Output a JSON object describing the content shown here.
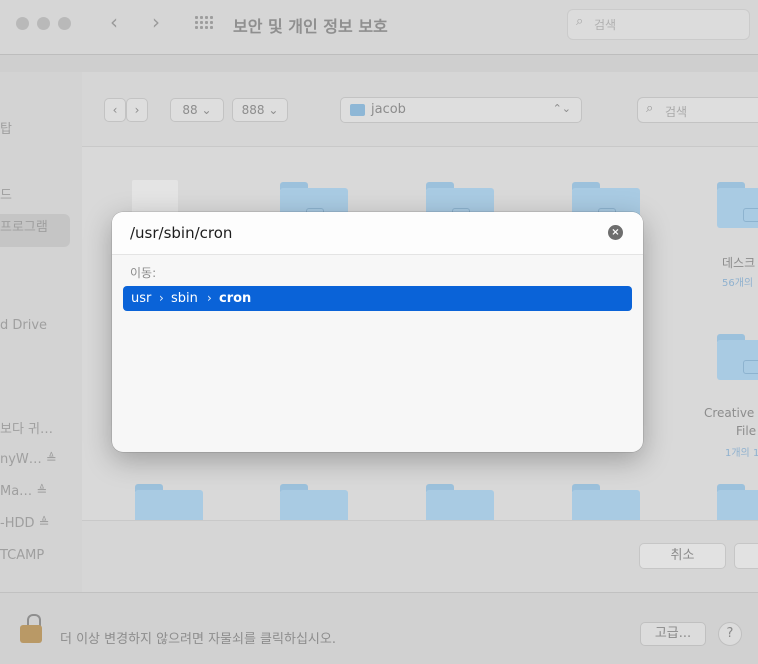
{
  "window": {
    "title": "보안 및 개인 정보 보호",
    "search_placeholder": "검색",
    "back_glyph": "‹",
    "forward_glyph": "›"
  },
  "sidebar": {
    "items": [
      "탑",
      "드",
      "프로그램",
      "d Drive",
      "보다 귀…",
      "nyW… ≜",
      "Ma… ≜",
      "-HDD ≜",
      "TCAMP"
    ]
  },
  "sheet": {
    "location": "jacob",
    "search_placeholder": "검색",
    "view_icons_label": "88 ⌄",
    "view_groups_label": "888 ⌄",
    "files": [
      {
        "name": "데스크",
        "sub": "56개의"
      },
      {
        "name": "Creative",
        "name2": "File",
        "sub": "1개의 1"
      }
    ],
    "cancel_label": "취소"
  },
  "goto": {
    "path_value": "/usr/sbin/cron",
    "clear_glyph": "×",
    "go_label": "이동:",
    "breadcrumb": [
      "usr",
      "sbin",
      "cron"
    ],
    "separator": "›"
  },
  "bottom": {
    "lock_text": "더 이상 변경하지 않으려면 자물쇠를 클릭하십시오.",
    "advanced_label": "고급...",
    "help_label": "?"
  },
  "colors": {
    "selection_blue": "#0a63d8",
    "folder_blue": "#a9cbe3"
  }
}
